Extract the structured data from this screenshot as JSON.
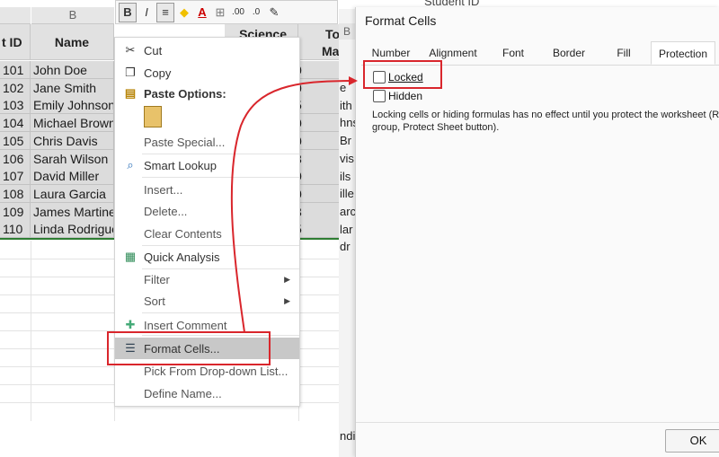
{
  "sheet": {
    "column_letter_b": "B",
    "headers": {
      "id": "t ID",
      "name": "Name",
      "science": "Science",
      "total": "Tot",
      "total2": "Ma"
    },
    "rows": [
      {
        "id": "101",
        "name": "John Doe"
      },
      {
        "id": "102",
        "name": "Jane Smith"
      },
      {
        "id": "103",
        "name": "Emily Johnson"
      },
      {
        "id": "104",
        "name": "Michael Brown"
      },
      {
        "id": "105",
        "name": "Chris Davis"
      },
      {
        "id": "106",
        "name": "Sarah Wilson"
      },
      {
        "id": "107",
        "name": "David Miller"
      },
      {
        "id": "108",
        "name": "Laura Garcia"
      },
      {
        "id": "109",
        "name": "James Martinez"
      },
      {
        "id": "110",
        "name": "Linda Rodrigues"
      }
    ],
    "science_digits": [
      "0",
      "0",
      "5",
      "0",
      "0",
      "8",
      "0",
      "0",
      "3",
      "5"
    ]
  },
  "toolbar": {
    "bold": "B",
    "italic": "I",
    "align": "≡",
    "fill": "◆",
    "font_color": "A",
    "borders": "⊞",
    "inc_decimal": ".00",
    "dec_decimal": ".0",
    "format_painter": "✎"
  },
  "menu": {
    "items": [
      {
        "label": "Cut",
        "icon": "scissors-icon"
      },
      {
        "label": "Copy",
        "icon": "copy-icon"
      },
      {
        "label": "Paste Options:",
        "icon": "clipboard-icon"
      },
      {
        "label": "Paste Special...",
        "icon": ""
      },
      {
        "label": "Smart Lookup",
        "icon": "search-icon"
      },
      {
        "label": "Insert...",
        "icon": ""
      },
      {
        "label": "Delete...",
        "icon": ""
      },
      {
        "label": "Clear Contents",
        "icon": ""
      },
      {
        "label": "Quick Analysis",
        "icon": "quick-analysis-icon"
      },
      {
        "label": "Filter",
        "icon": ""
      },
      {
        "label": "Sort",
        "icon": ""
      },
      {
        "label": "Insert Comment",
        "icon": "comment-icon"
      },
      {
        "label": "Format Cells...",
        "icon": "format-cells-icon"
      },
      {
        "label": "Pick From Drop-down List...",
        "icon": ""
      },
      {
        "label": "Define Name...",
        "icon": ""
      }
    ]
  },
  "peek": {
    "header": "Student ID",
    "col": "B",
    "fragments": [
      "e",
      "ith",
      "hns",
      "Br",
      "vis",
      "ils",
      "ille",
      "arc",
      "lar",
      "dr"
    ],
    "bottom": "ndi"
  },
  "dialog": {
    "title": "Format Cells",
    "tabs": [
      "Number",
      "Alignment",
      "Font",
      "Border",
      "Fill",
      "Protection"
    ],
    "active_tab": "Protection",
    "locked_label": "Locked",
    "hidden_label": "Hidden",
    "locked_checked": false,
    "hidden_checked": false,
    "note_line1": "Locking cells or hiding formulas has no effect until you protect the worksheet (Rev",
    "note_line2": "group, Protect Sheet button).",
    "ok_label": "OK"
  },
  "colors": {
    "annotation": "#d9262c",
    "selected_cell": "#dcdcdc",
    "highlight": "#c8c8c8"
  }
}
